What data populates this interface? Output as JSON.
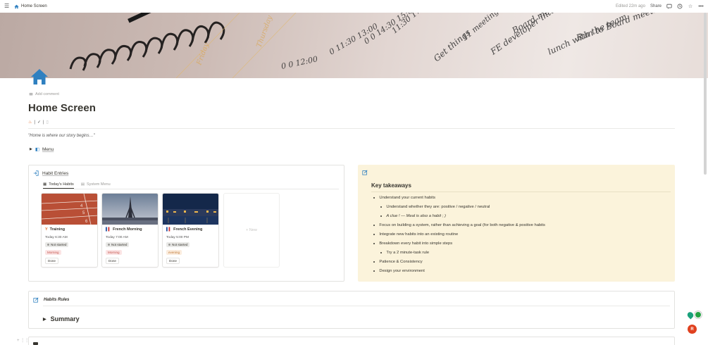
{
  "topbar": {
    "breadcrumb": "Home Screen",
    "edited": "Edited 22m ago",
    "share": "Share"
  },
  "page": {
    "add_comment": "Add comment",
    "title": "Home Screen",
    "status_row": [
      "|",
      "✓",
      "|"
    ],
    "quote": "\"Home is where our story begins…\"",
    "menu_label": "Menu"
  },
  "habits": {
    "header": "Habit Entries",
    "tabs": [
      {
        "label": "Today's Habits",
        "active": true
      },
      {
        "label": "System Menu",
        "active": false
      }
    ],
    "cards": [
      {
        "name": "Training",
        "time": "Today 6:30 AM",
        "status": "Not started",
        "tag": "Morning",
        "done": "Done",
        "icon": "training-icon"
      },
      {
        "name": "French Morning",
        "time": "Today 7:00 AM",
        "status": "Not started",
        "tag": "Morning",
        "done": "Done",
        "icon": "france-flag-icon"
      },
      {
        "name": "French Evening",
        "time": "Today 5:00 PM",
        "status": "Not started",
        "tag": "evening",
        "done": "Done",
        "icon": "france-flag-icon"
      }
    ],
    "new_label": "+ New"
  },
  "takeaways": {
    "title": "Key takeaways",
    "items": [
      {
        "text": "Understand your current habits",
        "level": 1
      },
      {
        "text": "Understand whether they are: positive / negative / neutral",
        "level": 2
      },
      {
        "text": "A clue ! — Meal is also a habit ; )",
        "level": 2,
        "italic": true
      },
      {
        "text": "Focus on building a system, rather than achieving a goal (for both negative & positive habits",
        "level": 1
      },
      {
        "text": " Integrate new habits into an existing routine",
        "level": 1
      },
      {
        "text": "Breakdown every habit into simple steps",
        "level": 1
      },
      {
        "text": "Try a 2 minute-task rule",
        "level": 2
      },
      {
        "text": "Patience & Consistency",
        "level": 1
      },
      {
        "text": "Design your environment",
        "level": 1
      }
    ]
  },
  "rules": {
    "header": "Habits Rules",
    "summary": "Summary"
  },
  "fab": {
    "avatar_letter": "R"
  },
  "colors": {
    "accent_blue": "#2f80c0",
    "callout_bg": "#fbf3db",
    "tag_red": "#c4554d",
    "tag_red_bg": "#fbe4e4"
  }
}
